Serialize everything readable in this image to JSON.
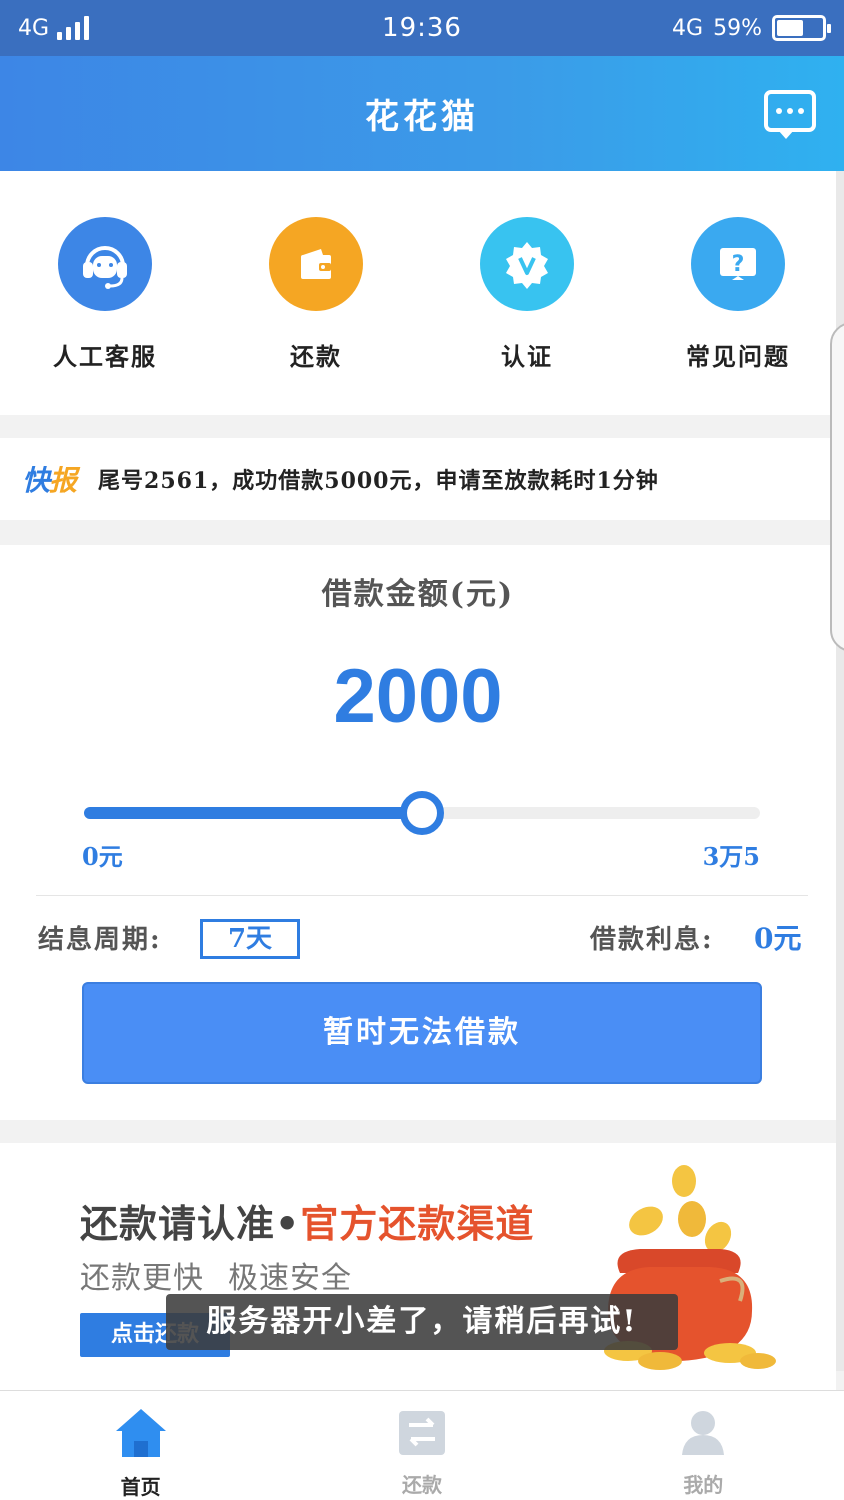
{
  "status_bar": {
    "network": "4G",
    "time": "19:36",
    "network_right": "4G",
    "battery_percent": "59%",
    "battery_level": 0.59
  },
  "header": {
    "title": "花花猫",
    "message_icon": "chat-bubble-icon"
  },
  "quick_actions": [
    {
      "label": "人工客服",
      "icon": "headset-icon",
      "color": "#3d86e6"
    },
    {
      "label": "还款",
      "icon": "wallet-icon",
      "color": "#f5a623"
    },
    {
      "label": "认证",
      "icon": "verified-badge-icon",
      "color": "#38c3f0"
    },
    {
      "label": "常见问题",
      "icon": "question-icon",
      "color": "#3aa9f0"
    }
  ],
  "news": {
    "tag_part1": "快",
    "tag_part2": "报",
    "text": "尾号2561，成功借款5000元，申请至放款耗时1分钟"
  },
  "loan": {
    "title": "借款金额(元)",
    "amount": "2000",
    "slider_fraction": 0.5,
    "slider_min": "0元",
    "slider_max": "3万5",
    "period_label": "结息周期:",
    "period_value": "7天",
    "interest_label": "借款利息:",
    "interest_value": "0元",
    "button_label": "暂时无法借款"
  },
  "banner": {
    "title_prefix": "还款请认准",
    "title_dot": "•",
    "title_highlight": "官方还款渠道",
    "sub1": "还款更快",
    "sub2": "极速安全",
    "button_label": "点击还款"
  },
  "toast": {
    "text": "服务器开小差了，请稍后再试!"
  },
  "tabs": [
    {
      "label": "首页",
      "icon": "home-icon",
      "active": true
    },
    {
      "label": "还款",
      "icon": "repay-icon",
      "active": false
    },
    {
      "label": "我的",
      "icon": "user-icon",
      "active": false
    }
  ],
  "colors": {
    "primary": "#2f7de1",
    "button": "#4a8ef5",
    "accent_red": "#e5532d",
    "accent_orange": "#f5a623"
  }
}
